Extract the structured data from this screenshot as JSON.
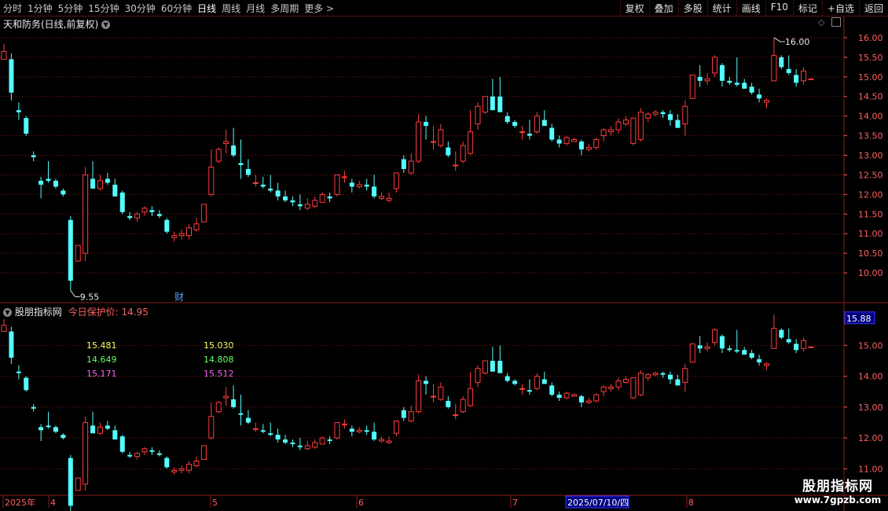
{
  "toolbar": {
    "periods": [
      "分时",
      "1分钟",
      "5分钟",
      "15分钟",
      "30分钟",
      "60分钟",
      "日线",
      "周线",
      "月线",
      "多周期",
      "更多 >"
    ],
    "active_period": "日线",
    "right_buttons": [
      "复权",
      "叠加",
      "多股",
      "统计",
      "画线",
      "F10",
      "标记",
      "+自选",
      "返回"
    ]
  },
  "main_chart": {
    "title": "天和防务(日线,前复权)",
    "y_ticks": [
      "16.00",
      "15.50",
      "15.00",
      "14.50",
      "14.00",
      "13.50",
      "13.00",
      "12.50",
      "12.00",
      "11.50",
      "11.00",
      "10.50",
      "10.00"
    ],
    "high_label": "16.00",
    "low_label": "9.55",
    "event_marker": "财"
  },
  "indicator": {
    "name": "股朋指标网",
    "label": "今日保护价:",
    "value": "14.95",
    "axis_highlight": "15.88",
    "y_ticks": [
      "15.00",
      "14.00",
      "13.00",
      "12.00",
      "11.00"
    ],
    "values_col1": [
      "15.481",
      "14.649",
      "15.171"
    ],
    "values_col2": [
      "15.030",
      "14.808",
      "15.512"
    ],
    "value_colors": [
      "#ffff66",
      "#66ff66",
      "#ff66ff"
    ]
  },
  "time_axis": {
    "labels": [
      "2025年",
      "4",
      "5",
      "6",
      "7",
      "8"
    ],
    "cursor_date": "2025/07/10/四"
  },
  "watermark": {
    "line1": "股朋指标网",
    "line2": "www.7gpzb.com"
  },
  "colors": {
    "up": "#ff3c3c",
    "down": "#54ffff",
    "grid": "#8a1c1c",
    "axis_text": "#ff6060"
  },
  "chart_data": {
    "type": "candlestick",
    "series": [
      {
        "ohlc": [
          [
            15.45,
            15.85,
            15.45,
            15.65
          ],
          [
            15.45,
            15.6,
            14.4,
            14.6
          ],
          [
            14.15,
            14.35,
            13.9,
            14.1
          ],
          [
            13.95,
            14.0,
            13.5,
            13.55
          ],
          [
            13.0,
            13.1,
            12.85,
            12.95
          ],
          [
            12.35,
            12.45,
            11.9,
            12.25
          ],
          [
            12.4,
            12.85,
            12.3,
            12.35
          ],
          [
            12.35,
            12.4,
            12.15,
            12.2
          ],
          [
            12.1,
            12.15,
            11.95,
            12.0
          ],
          [
            11.35,
            11.45,
            9.55,
            9.8
          ],
          [
            10.3,
            10.7,
            10.3,
            10.7
          ],
          [
            10.5,
            12.7,
            10.3,
            12.5
          ],
          [
            12.4,
            12.85,
            12.15,
            12.15
          ],
          [
            12.15,
            12.5,
            12.1,
            12.35
          ],
          [
            12.4,
            12.55,
            12.25,
            12.3
          ],
          [
            12.25,
            12.4,
            11.95,
            11.95
          ],
          [
            12.05,
            12.1,
            11.5,
            11.55
          ],
          [
            11.45,
            11.55,
            11.35,
            11.4
          ],
          [
            11.4,
            11.55,
            11.3,
            11.5
          ],
          [
            11.55,
            11.7,
            11.45,
            11.65
          ],
          [
            11.6,
            11.7,
            11.45,
            11.55
          ],
          [
            11.5,
            11.6,
            11.4,
            11.45
          ],
          [
            11.35,
            11.4,
            11.0,
            11.05
          ],
          [
            10.9,
            11.05,
            10.8,
            10.95
          ],
          [
            10.95,
            11.1,
            10.85,
            11.0
          ],
          [
            10.95,
            11.25,
            10.85,
            11.15
          ],
          [
            11.1,
            11.4,
            11.05,
            11.25
          ],
          [
            11.3,
            11.75,
            11.3,
            11.75
          ],
          [
            12.0,
            13.15,
            11.95,
            12.7
          ],
          [
            12.85,
            13.2,
            12.8,
            13.15
          ],
          [
            13.3,
            13.65,
            13.05,
            13.35
          ],
          [
            13.25,
            13.7,
            12.95,
            13.0
          ],
          [
            12.8,
            13.4,
            12.4,
            12.75
          ],
          [
            12.65,
            12.9,
            12.45,
            12.5
          ],
          [
            12.3,
            12.5,
            12.2,
            12.3
          ],
          [
            12.25,
            12.45,
            12.15,
            12.2
          ],
          [
            12.15,
            12.5,
            12.05,
            12.1
          ],
          [
            12.1,
            12.3,
            11.85,
            11.95
          ],
          [
            11.95,
            12.1,
            11.8,
            11.85
          ],
          [
            11.85,
            11.95,
            11.7,
            11.8
          ],
          [
            11.75,
            12.0,
            11.6,
            11.7
          ],
          [
            11.65,
            11.9,
            11.6,
            11.75
          ],
          [
            11.7,
            11.95,
            11.65,
            11.85
          ],
          [
            11.8,
            12.05,
            11.8,
            12.0
          ],
          [
            11.95,
            12.05,
            11.8,
            11.9
          ],
          [
            12.0,
            12.5,
            11.95,
            12.5
          ],
          [
            12.45,
            12.6,
            12.3,
            12.45
          ],
          [
            12.3,
            12.4,
            12.05,
            12.2
          ],
          [
            12.2,
            12.35,
            12.15,
            12.25
          ],
          [
            12.25,
            12.4,
            12.1,
            12.2
          ],
          [
            12.2,
            12.5,
            11.9,
            11.95
          ],
          [
            11.9,
            12.05,
            11.85,
            11.95
          ],
          [
            11.85,
            12.05,
            11.8,
            11.9
          ],
          [
            12.15,
            12.55,
            12.05,
            12.55
          ],
          [
            12.9,
            13.0,
            12.55,
            12.65
          ],
          [
            12.55,
            13.05,
            12.5,
            12.85
          ],
          [
            12.85,
            14.05,
            12.8,
            13.85
          ],
          [
            13.85,
            14.0,
            13.4,
            13.75
          ],
          [
            13.35,
            13.75,
            13.15,
            13.35
          ],
          [
            13.25,
            13.8,
            13.2,
            13.65
          ],
          [
            13.2,
            13.35,
            12.95,
            13.0
          ],
          [
            12.75,
            13.1,
            12.6,
            12.75
          ],
          [
            12.85,
            13.35,
            12.8,
            13.25
          ],
          [
            13.05,
            14.15,
            13.0,
            13.6
          ],
          [
            13.8,
            14.35,
            13.65,
            14.25
          ],
          [
            14.1,
            14.5,
            14.05,
            14.5
          ],
          [
            14.5,
            14.95,
            14.25,
            14.15
          ],
          [
            14.5,
            15.0,
            14.15,
            14.1
          ],
          [
            14.0,
            14.1,
            13.8,
            13.85
          ],
          [
            13.85,
            13.9,
            13.7,
            13.75
          ],
          [
            13.6,
            13.75,
            13.4,
            13.6
          ],
          [
            13.55,
            13.9,
            13.4,
            13.5
          ],
          [
            13.6,
            14.1,
            13.55,
            14.0
          ],
          [
            13.9,
            14.15,
            13.75,
            13.75
          ],
          [
            13.7,
            13.8,
            13.35,
            13.4
          ],
          [
            13.4,
            13.5,
            13.2,
            13.3
          ],
          [
            13.3,
            13.5,
            13.25,
            13.45
          ],
          [
            13.35,
            13.45,
            13.35,
            13.4
          ],
          [
            13.35,
            13.4,
            13.0,
            13.15
          ],
          [
            13.15,
            13.3,
            13.1,
            13.2
          ],
          [
            13.2,
            13.45,
            13.15,
            13.4
          ],
          [
            13.5,
            13.7,
            13.35,
            13.65
          ],
          [
            13.6,
            13.75,
            13.5,
            13.65
          ],
          [
            13.65,
            13.95,
            13.55,
            13.85
          ],
          [
            13.8,
            14.0,
            13.75,
            13.9
          ],
          [
            13.3,
            13.95,
            13.25,
            13.95
          ],
          [
            13.4,
            14.2,
            13.35,
            14.1
          ],
          [
            13.95,
            14.1,
            13.85,
            14.05
          ],
          [
            14.05,
            14.15,
            14.0,
            14.1
          ],
          [
            14.1,
            14.15,
            13.95,
            14.05
          ],
          [
            14.05,
            14.15,
            13.75,
            13.9
          ],
          [
            13.9,
            14.05,
            13.7,
            13.7
          ],
          [
            13.8,
            14.4,
            13.5,
            14.25
          ],
          [
            14.45,
            15.05,
            14.45,
            15.05
          ],
          [
            15.0,
            15.3,
            14.75,
            14.9
          ],
          [
            14.9,
            15.1,
            14.8,
            14.95
          ],
          [
            15.1,
            15.55,
            15.0,
            15.5
          ],
          [
            15.3,
            15.35,
            14.75,
            14.9
          ],
          [
            14.9,
            15.0,
            14.8,
            14.85
          ],
          [
            14.85,
            15.5,
            14.75,
            14.8
          ],
          [
            14.85,
            14.95,
            14.7,
            14.7
          ],
          [
            14.75,
            14.85,
            14.55,
            14.6
          ],
          [
            14.55,
            14.7,
            14.35,
            14.45
          ],
          [
            14.35,
            14.45,
            14.2,
            14.4
          ],
          [
            14.9,
            16.0,
            14.95,
            15.55
          ],
          [
            15.5,
            15.55,
            15.2,
            15.25
          ],
          [
            15.2,
            15.55,
            15.05,
            15.1
          ],
          [
            15.05,
            15.2,
            14.75,
            14.85
          ],
          [
            14.9,
            15.25,
            14.8,
            15.15
          ],
          [
            14.95,
            14.95,
            14.95,
            14.95
          ]
        ]
      }
    ],
    "y_range_main": [
      9.5,
      16.2
    ],
    "y_range_indicator": [
      10.6,
      15.9
    ],
    "x_labels": [
      "2025年",
      "4",
      "5",
      "6",
      "7",
      "8"
    ]
  }
}
